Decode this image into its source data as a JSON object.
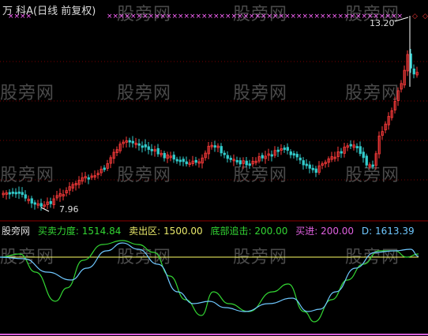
{
  "title": "万 科A(日线 前复权)",
  "watermark": "股旁网",
  "price_high": "13.20",
  "price_low": "7.96",
  "indicator": {
    "name": "股旁网",
    "items": [
      {
        "label": "买卖力度:",
        "value": "1514.84",
        "color": "#33d633"
      },
      {
        "label": "卖出区:",
        "value": "1500.00",
        "color": "#e8e86a"
      },
      {
        "label": "底部追击:",
        "value": "200.00",
        "color": "#33d633"
      },
      {
        "label": "买进:",
        "value": "200.00",
        "color": "#e060e0"
      },
      {
        "label": "D:",
        "value": "1613.39",
        "color": "#6fc8ff"
      }
    ]
  },
  "colors": {
    "up": "#ff3b3b",
    "down": "#33cccc",
    "grid": "#7a0000",
    "ma_line": "#ffff66",
    "d_line": "#6fc8ff",
    "force_line": "#33d633",
    "buy_line": "#e060e0",
    "signal": "#ff66ff"
  }
}
